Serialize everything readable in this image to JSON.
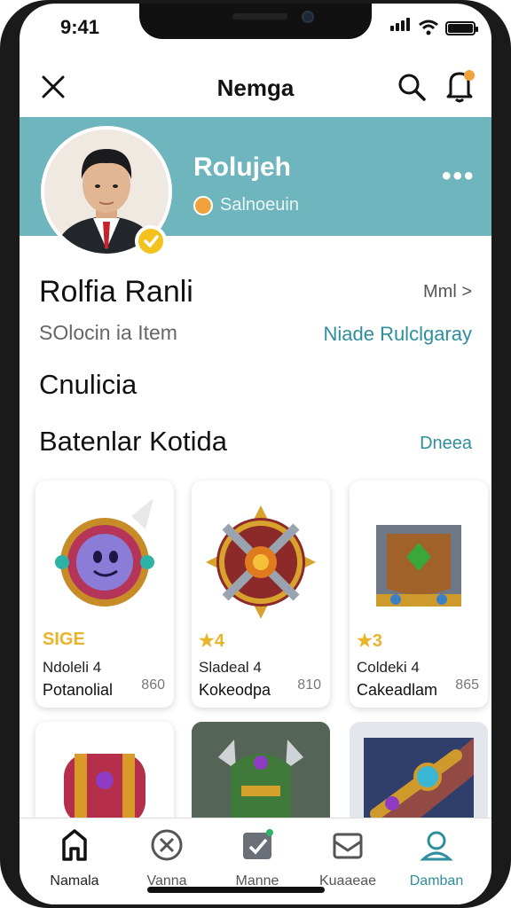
{
  "status": {
    "time": "9:41"
  },
  "header": {
    "title": "Nemga"
  },
  "banner": {
    "name": "Rolujeh",
    "subtitle": "Salnoeuin",
    "more": "•••"
  },
  "profile": {
    "name": "Rolfia Ranli",
    "link": "Mml >",
    "subtitle": "SOlocin ia Item",
    "action": "Niade Rulclgaray"
  },
  "sections": {
    "first": "Cnulicia",
    "second": "Batenlar Kotida",
    "see_more": "Dneea"
  },
  "cards": [
    {
      "stars": "SIGE",
      "line1": "Ndoleli 4",
      "line2": "Potanolial",
      "price": "860"
    },
    {
      "stars": "★4",
      "line1": "Sladeal 4",
      "line2": "Kokeodpa",
      "price": "810"
    },
    {
      "stars": "★3",
      "line1": "Coldeki 4",
      "line2": "Cakeadlam",
      "price": "865"
    }
  ],
  "nav": [
    {
      "label": "Namala"
    },
    {
      "label": "Vanna"
    },
    {
      "label": "Manne"
    },
    {
      "label": "Kuaaeae"
    },
    {
      "label": "Damban"
    }
  ],
  "colors": {
    "accent": "#2e8e9d",
    "banner": "#6fb5bd",
    "star": "#e9b42a"
  }
}
